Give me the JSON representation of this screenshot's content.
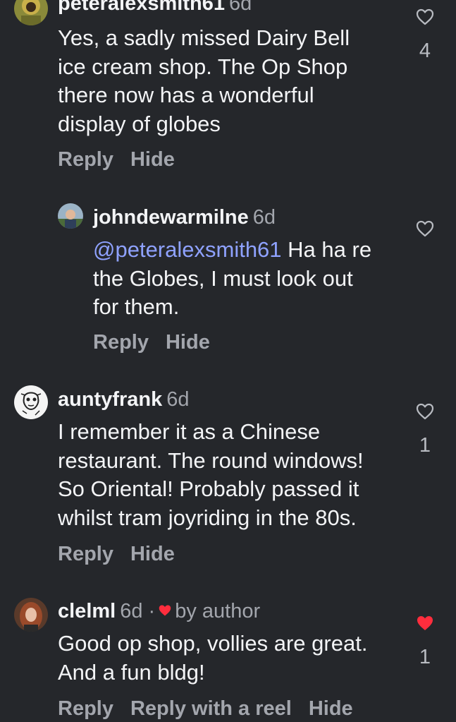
{
  "comments": [
    {
      "username": "peteralexsmith61",
      "time": "6d",
      "text": "Yes, a sadly missed Dairy Bell\nice cream shop. The Op Shop\nthere now has a wonderful\ndisplay of globes",
      "likes": "4",
      "liked": false,
      "actions": [
        "Reply",
        "Hide"
      ]
    },
    {
      "username": "johndewarmilne",
      "time": "6d",
      "mention": "@peteralexsmith61",
      "text": " Ha ha re\nthe Globes, I must look out\nfor them.",
      "likes": "",
      "liked": false,
      "actions": [
        "Reply",
        "Hide"
      ]
    },
    {
      "username": "auntyfrank",
      "time": "6d",
      "text": "I remember it as a Chinese\nrestaurant. The round windows!\nSo Oriental! Probably passed it\nwhilst tram joyriding in the 80s.",
      "likes": "1",
      "liked": false,
      "actions": [
        "Reply",
        "Hide"
      ]
    },
    {
      "username": "clelml",
      "time": "6d",
      "separator": "·",
      "author_badge": "by author",
      "text": "Good op shop, vollies are great.\nAnd a fun bldg!",
      "likes": "1",
      "liked": true,
      "actions": [
        "Reply",
        "Reply with a reel",
        "Hide"
      ]
    }
  ],
  "colors": {
    "background": "#25272b",
    "text": "#f3f4f6",
    "muted": "#a3a6ad",
    "mention": "#8fa2ff",
    "liked": "#ff2d3d"
  },
  "icons": {
    "like": "heart-outline-icon",
    "liked": "heart-filled-icon"
  }
}
